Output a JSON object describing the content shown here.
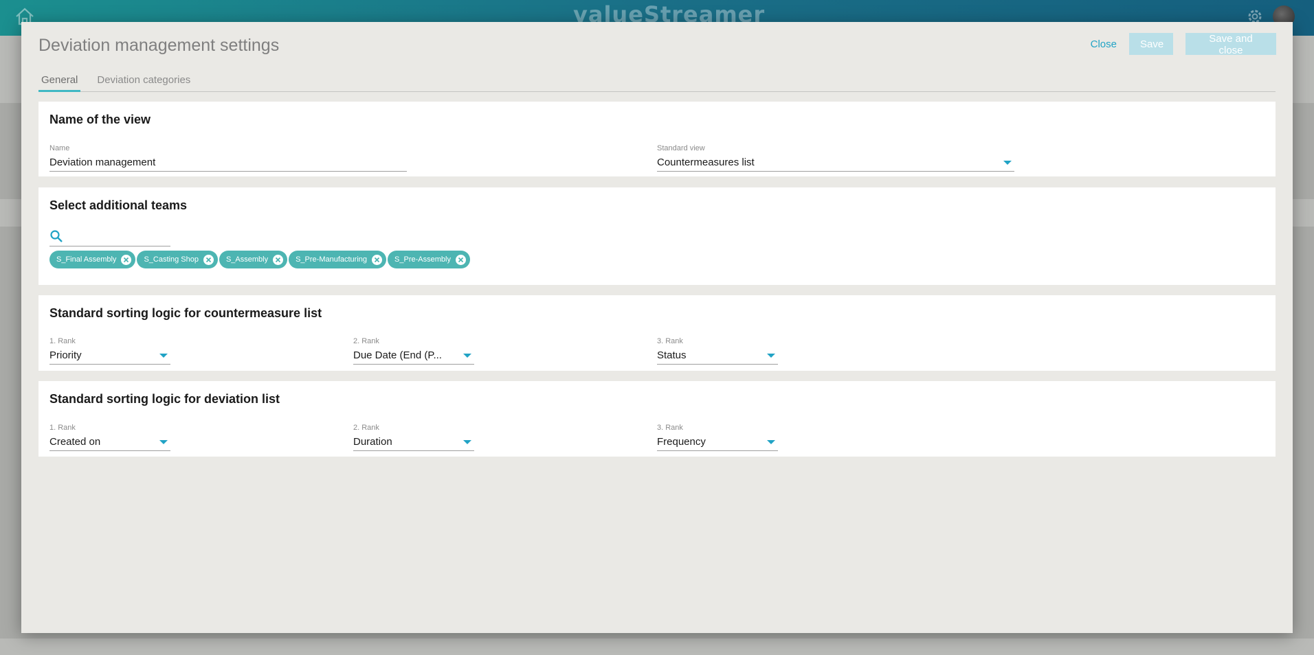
{
  "app": {
    "logo": "valueStreamer"
  },
  "modal": {
    "title": "Deviation management settings",
    "close_label": "Close",
    "save_label": "Save",
    "save_close_label": "Save and close"
  },
  "tabs": [
    {
      "label": "General",
      "active": true
    },
    {
      "label": "Deviation categories",
      "active": false
    }
  ],
  "view_name": {
    "heading": "Name of the view",
    "name_label": "Name",
    "name_value": "Deviation management",
    "standard_view_label": "Standard view",
    "standard_view_value": "Countermeasures list"
  },
  "teams": {
    "heading": "Select additional teams",
    "search_value": "",
    "chips": [
      "S_Final Assembly",
      "S_Casting Shop",
      "S_Assembly",
      "S_Pre-Manufacturing",
      "S_Pre-Assembly"
    ]
  },
  "countermeasure_sort": {
    "heading": "Standard sorting logic for countermeasure list",
    "ranks": [
      {
        "label": "1. Rank",
        "value": "Priority"
      },
      {
        "label": "2. Rank",
        "value": "Due Date (End (P..."
      },
      {
        "label": "3. Rank",
        "value": "Status"
      }
    ]
  },
  "deviation_sort": {
    "heading": "Standard sorting logic for deviation list",
    "ranks": [
      {
        "label": "1. Rank",
        "value": "Created on"
      },
      {
        "label": "2. Rank",
        "value": "Duration"
      },
      {
        "label": "3. Rank",
        "value": "Frequency"
      }
    ]
  },
  "colors": {
    "accent": "#21a3c5",
    "chip": "#4db5b2",
    "disabled_button": "#b9dfe8",
    "modal_bg": "#eae9e5"
  }
}
